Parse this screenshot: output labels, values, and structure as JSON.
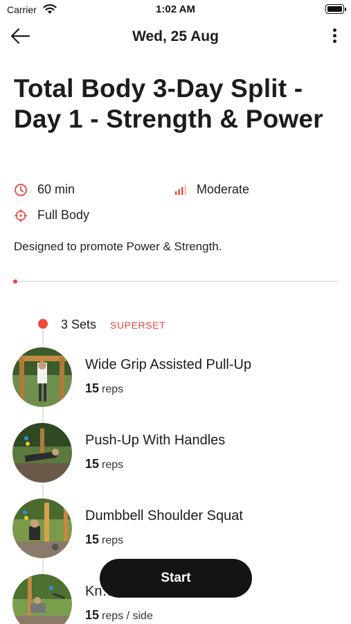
{
  "status_bar": {
    "carrier": "Carrier",
    "time": "1:02 AM"
  },
  "nav": {
    "title": "Wed, 25 Aug",
    "back_icon": "arrow-left-icon",
    "more_icon": "more-vertical-icon"
  },
  "workout": {
    "title": "Total Body 3-Day Split - Day 1 - Strength & Power",
    "duration": "60 min",
    "level": "Moderate",
    "focus": "Full Body",
    "description": "Designed to promote Power & Strength.",
    "progress": 0
  },
  "block": {
    "sets": "3 Sets",
    "tag": "SUPERSET",
    "exercises": [
      {
        "name": "Wide Grip Assisted Pull-Up",
        "count": "15",
        "unit": "reps"
      },
      {
        "name": "Push-Up With Handles",
        "count": "15",
        "unit": "reps"
      },
      {
        "name": "Dumbbell Shoulder Squat",
        "count": "15",
        "unit": "reps"
      },
      {
        "name": "Kn… Stretch",
        "count": "15",
        "unit": "reps / side"
      }
    ]
  },
  "start_button": {
    "label": "Start"
  },
  "colors": {
    "accent": "#e8433a",
    "button_bg": "#141414",
    "text": "#1c1c1c"
  }
}
